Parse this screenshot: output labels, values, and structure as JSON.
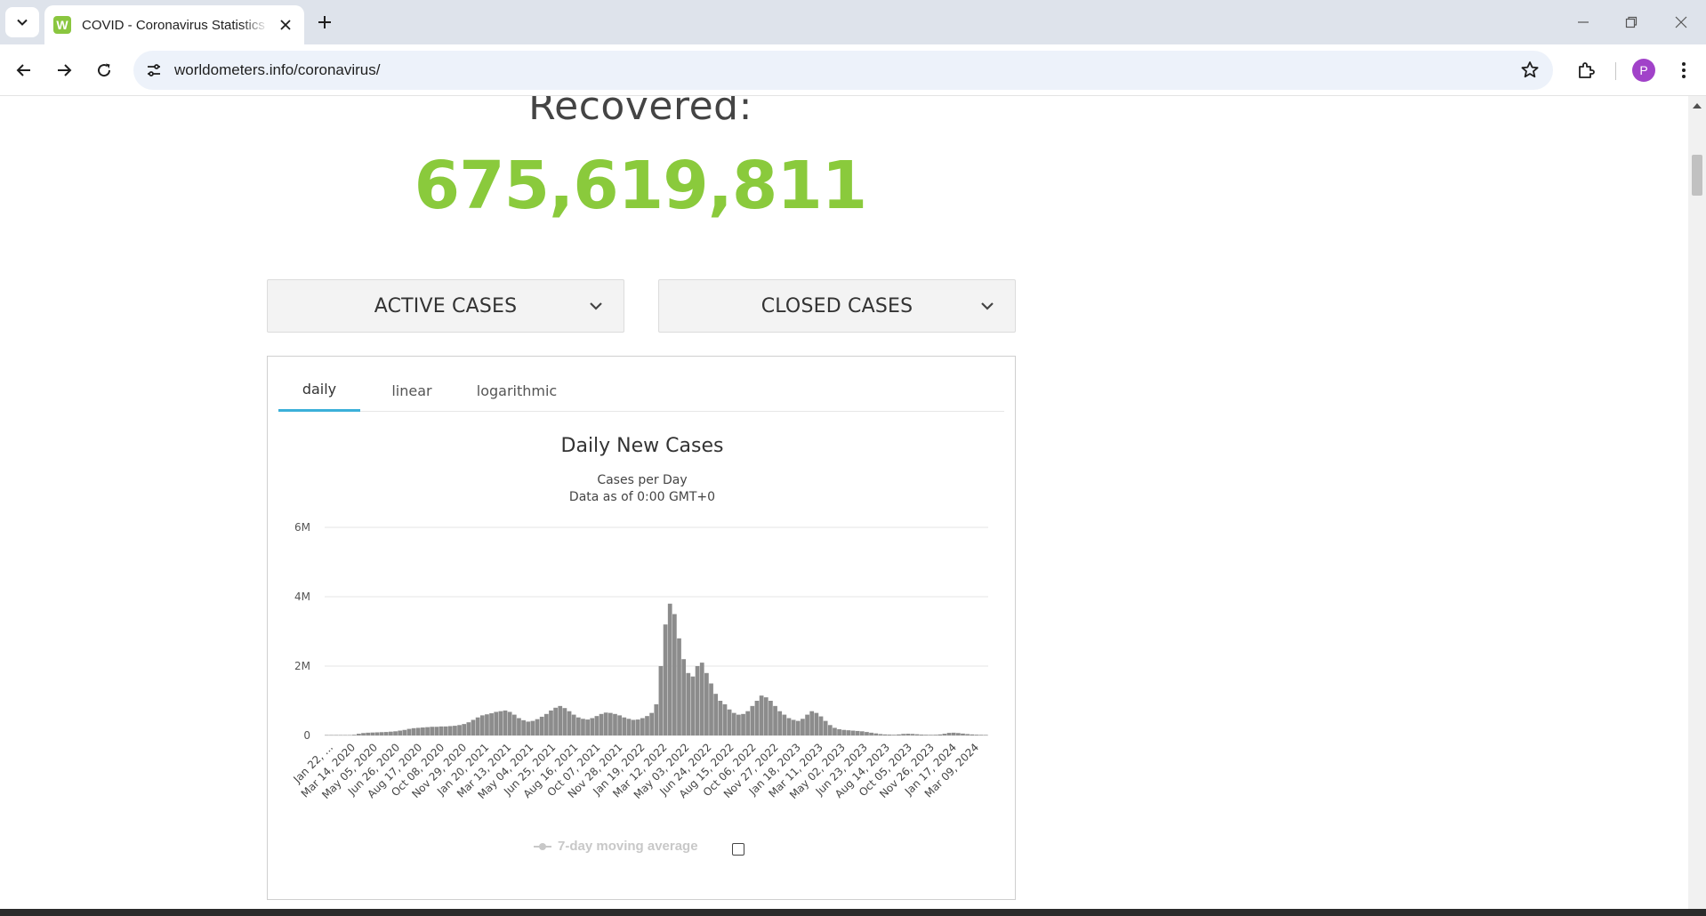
{
  "browser": {
    "tab_title": "COVID - Coronavirus Statistics - Worldometer",
    "favicon_letter": "W",
    "url": "worldometers.info/coronavirus/",
    "profile_initial": "P"
  },
  "page": {
    "recovered_label": "Recovered:",
    "recovered_value": "675,619,811",
    "dropdowns": [
      "ACTIVE CASES",
      "CLOSED CASES"
    ],
    "chart_tabs": [
      "daily",
      "linear",
      "logarithmic"
    ],
    "active_chart_tab": "daily",
    "chart_title": "Daily New Cases",
    "chart_subtitle_line1": "Cases per Day",
    "chart_subtitle_line2": "Data as of 0:00 GMT+0",
    "legend_label": "7-day moving average",
    "legend_checked": false
  },
  "colors": {
    "recovered_green": "#8aca3c",
    "bar_gray": "#8c8c8c",
    "active_tab_underline": "#3bb0d9"
  },
  "chart_data": {
    "type": "bar",
    "title": "Daily New Cases",
    "subtitle": [
      "Cases per Day",
      "Data as of 0:00 GMT+0"
    ],
    "ylim": [
      0,
      6000000
    ],
    "y_ticks": [
      {
        "value": 0,
        "label": "0"
      },
      {
        "value": 2000000,
        "label": "2M"
      },
      {
        "value": 4000000,
        "label": "4M"
      },
      {
        "value": 6000000,
        "label": "6M"
      }
    ],
    "x_tick_labels": [
      "Jan 22, ...",
      "Mar 14, 2020",
      "May 05, 2020",
      "Jun 26, 2020",
      "Aug 17, 2020",
      "Oct 08, 2020",
      "Nov 29, 2020",
      "Jan 20, 2021",
      "Mar 13, 2021",
      "May 04, 2021",
      "Jun 25, 2021",
      "Aug 16, 2021",
      "Oct 07, 2021",
      "Nov 28, 2021",
      "Jan 19, 2022",
      "Mar 12, 2022",
      "May 03, 2022",
      "Jun 24, 2022",
      "Aug 15, 2022",
      "Oct 06, 2022",
      "Nov 27, 2022",
      "Jan 18, 2023",
      "Mar 11, 2023",
      "May 02, 2023",
      "Jun 23, 2023",
      "Aug 14, 2023",
      "Oct 05, 2023",
      "Nov 26, 2023",
      "Jan 17, 2024",
      "Mar 09, 2024"
    ],
    "grid": true,
    "series": [
      {
        "unit": "approximate average daily new cases per week",
        "x_start": "Jan 22, 2020",
        "values": [
          500,
          2000,
          3000,
          4000,
          5000,
          8000,
          20000,
          50000,
          70000,
          80000,
          85000,
          90000,
          95000,
          100000,
          110000,
          120000,
          140000,
          160000,
          190000,
          210000,
          220000,
          230000,
          240000,
          250000,
          250000,
          260000,
          260000,
          270000,
          280000,
          300000,
          330000,
          380000,
          450000,
          520000,
          580000,
          610000,
          640000,
          680000,
          700000,
          720000,
          680000,
          600000,
          500000,
          440000,
          400000,
          420000,
          470000,
          540000,
          620000,
          720000,
          800000,
          850000,
          790000,
          700000,
          600000,
          520000,
          480000,
          460000,
          500000,
          560000,
          620000,
          660000,
          650000,
          620000,
          580000,
          520000,
          480000,
          450000,
          460000,
          500000,
          560000,
          650000,
          900000,
          2000000,
          3200000,
          3800000,
          3500000,
          2800000,
          2200000,
          1800000,
          1700000,
          2000000,
          2100000,
          1800000,
          1500000,
          1200000,
          1000000,
          900000,
          750000,
          650000,
          600000,
          620000,
          700000,
          850000,
          1000000,
          1150000,
          1100000,
          1000000,
          850000,
          700000,
          600000,
          500000,
          450000,
          420000,
          480000,
          600000,
          700000,
          650000,
          550000,
          420000,
          300000,
          220000,
          180000,
          160000,
          150000,
          140000,
          130000,
          120000,
          100000,
          80000,
          60000,
          40000,
          30000,
          25000,
          20000,
          30000,
          45000,
          50000,
          45000,
          35000,
          25000,
          20000,
          18000,
          20000,
          30000,
          50000,
          75000,
          80000,
          70000,
          55000,
          40000,
          30000,
          22000,
          18000,
          15000
        ]
      }
    ]
  }
}
